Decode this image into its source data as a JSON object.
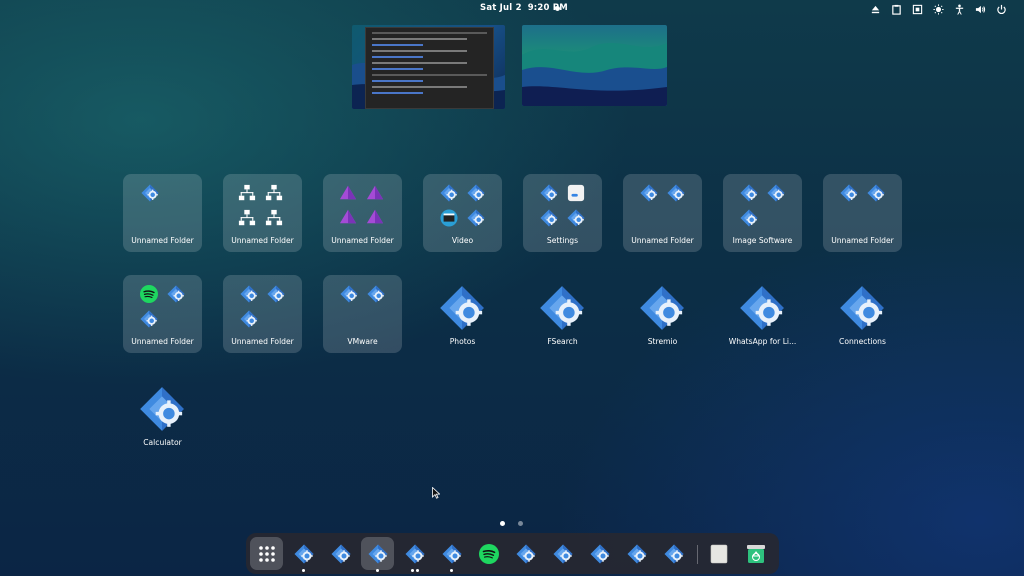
{
  "top_bar": {
    "date": "Sat Jul 2",
    "time": "9:20 PM",
    "tray_icons": [
      "eject-icon",
      "clipboard-icon",
      "screenshot-icon",
      "brightness-icon",
      "accessibility-icon",
      "volume-icon",
      "power-icon"
    ]
  },
  "workspaces": [
    {
      "name": "workspace-1"
    },
    {
      "name": "workspace-2"
    }
  ],
  "app_grid": {
    "row1": [
      {
        "label": "Unnamed Folder",
        "type": "folder"
      },
      {
        "label": "Unnamed Folder",
        "type": "folder"
      },
      {
        "label": "Unnamed Folder",
        "type": "folder"
      },
      {
        "label": "Video",
        "type": "folder"
      },
      {
        "label": "Settings",
        "type": "folder"
      },
      {
        "label": "Unnamed Folder",
        "type": "folder"
      },
      {
        "label": "Image Software",
        "type": "folder"
      },
      {
        "label": "Unnamed Folder",
        "type": "folder"
      }
    ],
    "row2": [
      {
        "label": "Unnamed Folder",
        "type": "folder"
      },
      {
        "label": "Unnamed Folder",
        "type": "folder"
      },
      {
        "label": "VMware",
        "type": "folder"
      },
      {
        "label": "Photos",
        "type": "app"
      },
      {
        "label": "FSearch",
        "type": "app"
      },
      {
        "label": "Stremio",
        "type": "app"
      },
      {
        "label": "WhatsApp for Li...",
        "type": "app"
      },
      {
        "label": "Connections",
        "type": "app"
      }
    ],
    "row3": [
      {
        "label": "Calculator",
        "type": "app"
      }
    ]
  },
  "pages": {
    "count": 2,
    "current": 1
  },
  "dock": {
    "apps": [
      "show-apps",
      "generic-app",
      "generic-app",
      "generic-app",
      "generic-app",
      "generic-app",
      "spotify",
      "generic-app",
      "generic-app",
      "generic-app",
      "generic-app",
      "generic-app",
      "text-editor",
      "trash"
    ]
  },
  "colors": {
    "accent": "#3584e4",
    "spotify": "#1ed760",
    "folder": "rgba(255,255,255,0.16)"
  }
}
